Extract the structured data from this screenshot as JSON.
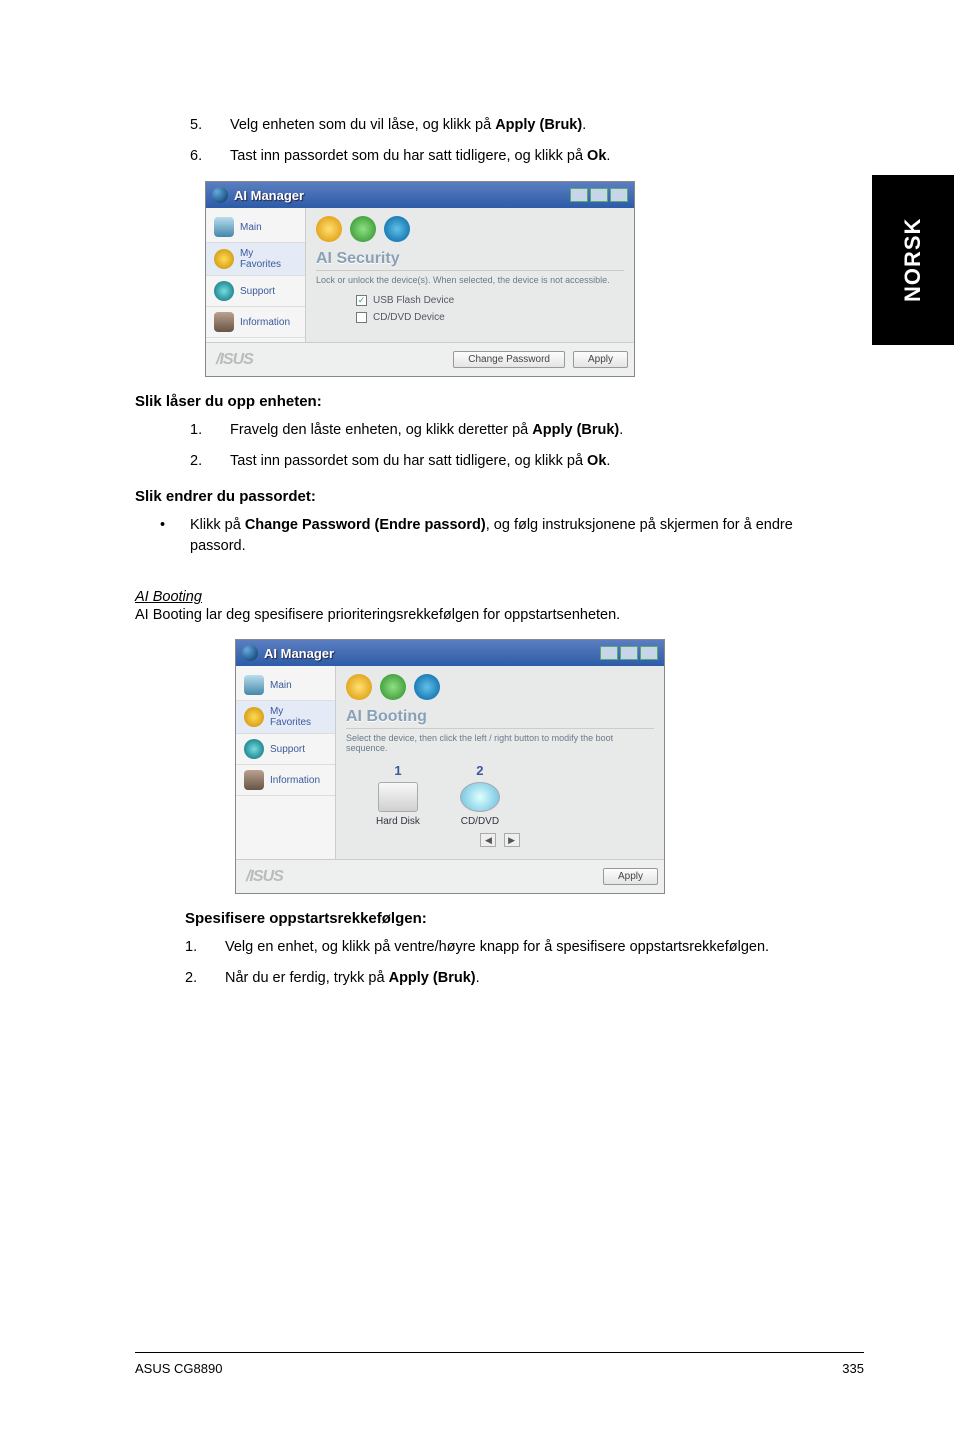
{
  "sideTab": "NORSK",
  "steps_top": [
    {
      "num": "5.",
      "text_before": "Velg enheten som du vil låse, og klikk på ",
      "bold": "Apply (Bruk)",
      "text_after": "."
    },
    {
      "num": "6.",
      "text_before": "Tast inn passordet som du har satt tidligere, og klikk på ",
      "bold": "Ok",
      "text_after": "."
    }
  ],
  "panel1": {
    "title": "AI Manager",
    "sidebar": [
      "Main",
      "My Favorites",
      "Support",
      "Information"
    ],
    "sectionTitle": "AI Security",
    "desc": "Lock or unlock the device(s). When selected, the device is not accessible.",
    "chk1": "USB Flash Device",
    "chk1_checked": "✓",
    "chk2": "CD/DVD Device",
    "btn_change": "Change Password",
    "btn_apply": "Apply",
    "brand": "/ISUS"
  },
  "unlock_heading": "Slik låser du opp enheten:",
  "unlock_steps": [
    {
      "num": "1.",
      "text_before": "Fravelg den låste enheten, og klikk deretter på ",
      "bold": "Apply (Bruk)",
      "text_after": "."
    },
    {
      "num": "2.",
      "text_before": "Tast inn passordet som du har satt tidligere, og klikk på ",
      "bold": "Ok",
      "text_after": "."
    }
  ],
  "changepw_heading": "Slik endrer du passordet:",
  "changepw_bullet": {
    "dot": "•",
    "text_before": "Klikk på ",
    "bold": "Change Password (Endre passord)",
    "text_after": ", og følg instruksjonene på skjermen for å endre passord."
  },
  "booting_title": "AI Booting",
  "booting_para": "AI Booting lar deg spesifisere prioriteringsrekkefølgen for oppstartsenheten.",
  "panel2": {
    "title": "AI Manager",
    "sidebar": [
      "Main",
      "My Favorites",
      "Support",
      "Information"
    ],
    "sectionTitle": "AI Booting",
    "desc": "Select the device, then click the left / right button to modify the boot sequence.",
    "col1num": "1",
    "col1label": "Hard Disk",
    "col2num": "2",
    "col2label": "CD/DVD",
    "left_sym": "◀",
    "right_sym": "▶",
    "btn_apply": "Apply",
    "brand": "/ISUS"
  },
  "specify_heading": "Spesifisere oppstartsrekkefølgen:",
  "specify_steps": [
    {
      "num": "1.",
      "text": "Velg en enhet, og klikk på ventre/høyre knapp for å spesifisere oppstartsrekkefølgen."
    },
    {
      "num": "2.",
      "text_before": "Når du er ferdig, trykk på ",
      "bold": "Apply (Bruk)",
      "text_after": "."
    }
  ],
  "footer": {
    "left": "ASUS CG8890",
    "right": "335"
  }
}
